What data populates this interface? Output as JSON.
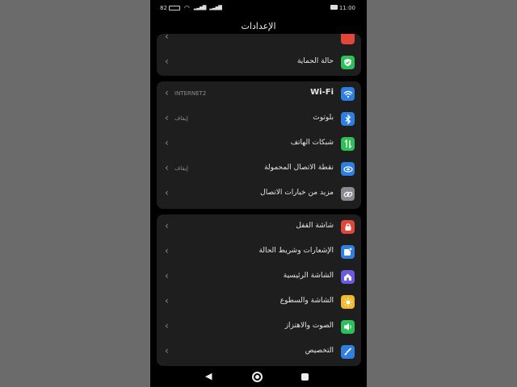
{
  "status_bar": {
    "time": "11:00",
    "battery": "82"
  },
  "header": {
    "title": "الإعدادات"
  },
  "top_card": {
    "rows": [
      {
        "label": "حالة الحماية",
        "icon": "shield-check-icon",
        "color": "#2fbf5a"
      }
    ]
  },
  "connectivity": {
    "rows": [
      {
        "label": "Wi-Fi",
        "value": "INTERNET2",
        "icon": "wifi-icon",
        "color": "#2f7fe0"
      },
      {
        "label": "بلوتوث",
        "value": "إيقاف",
        "icon": "bluetooth-icon",
        "color": "#2f7fe0"
      },
      {
        "label": "شبكات الهاتف",
        "value": "",
        "icon": "mobile-data-icon",
        "color": "#2fbf5a"
      },
      {
        "label": "نقطة الاتصال المحمولة",
        "value": "إيقاف",
        "icon": "hotspot-icon",
        "color": "#2f7fe0"
      },
      {
        "label": "مزيد من خيارات الاتصال",
        "value": "",
        "icon": "link-icon",
        "color": "#8a8a90"
      }
    ]
  },
  "device": {
    "rows": [
      {
        "label": "شاشة القفل",
        "icon": "lock-icon",
        "color": "#e0463a"
      },
      {
        "label": "الإشعارات وشريط الحالة",
        "icon": "notification-icon",
        "color": "#2f7fe0"
      },
      {
        "label": "الشاشة الرئيسية",
        "icon": "home-icon",
        "color": "#6a5ce0"
      },
      {
        "label": "الشاشة والسطوع",
        "icon": "brightness-icon",
        "color": "#f0b82a"
      },
      {
        "label": "الصوت والاهتزاز",
        "icon": "sound-icon",
        "color": "#2fbf5a"
      },
      {
        "label": "التخصيص",
        "icon": "brush-icon",
        "color": "#2f7fe0"
      }
    ]
  }
}
